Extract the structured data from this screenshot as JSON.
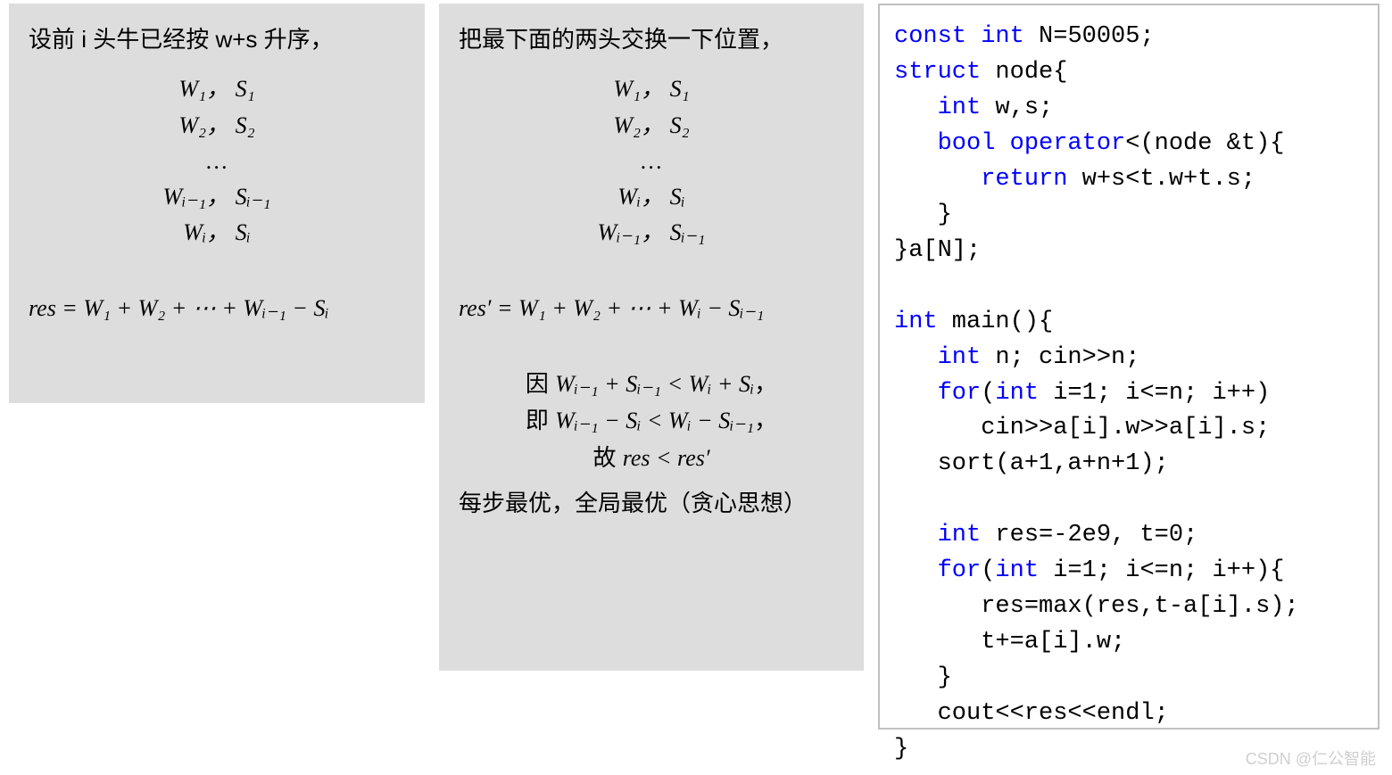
{
  "left": {
    "title": "设前 i 头牛已经按 w+s 升序，",
    "rows": [
      "W₁，  S₁",
      "W₂，  S₂",
      "…",
      "Wᵢ₋₁，  Sᵢ₋₁",
      "Wᵢ，  Sᵢ"
    ],
    "result": "res = W₁ + W₂ + ⋯ + Wᵢ₋₁ − Sᵢ"
  },
  "mid": {
    "title": "把最下面的两头交换一下位置，",
    "rows": [
      "W₁，  S₁",
      "W₂，  S₂",
      "…",
      "Wᵢ，  Sᵢ",
      "Wᵢ₋₁，  Sᵢ₋₁"
    ],
    "result": "res′ = W₁ + W₂ + ⋯ + Wᵢ − Sᵢ₋₁",
    "proof1_pre": "因 ",
    "proof1_math": "Wᵢ₋₁ + Sᵢ₋₁ < Wᵢ + Sᵢ",
    "proof1_post": "，",
    "proof2_pre": "即 ",
    "proof2_math": "Wᵢ₋₁ − Sᵢ < Wᵢ − Sᵢ₋₁",
    "proof2_post": "，",
    "proof3_pre": "故 ",
    "proof3_math": "res < res′",
    "conclusion": "每步最优，全局最优（贪心思想）"
  },
  "code": {
    "l1a": "const",
    "l1b": " int",
    "l1c": " N=",
    "l1d": "50005",
    "l1e": ";",
    "l2a": "struct",
    "l2b": " node{",
    "l3a": "   int",
    "l3b": " w,s;",
    "l4a": "   bool",
    "l4b": " operator",
    "l4c": "<(node &t){",
    "l5a": "      return",
    "l5b": " w+s<t.w+t.s;",
    "l6": "   }",
    "l7": "}a[N];",
    "l8": "",
    "l9a": "int",
    "l9b": " main(){",
    "l10a": "   int",
    "l10b": " n; cin>>n;",
    "l11a": "   for",
    "l11b": "(",
    "l11c": "int",
    "l11d": " i=",
    "l11e": "1",
    "l11f": "; i<=n; i++)",
    "l12": "      cin>>a[i].w>>a[i].s;",
    "l13a": "   sort(a+",
    "l13b": "1",
    "l13c": ",a+n+",
    "l13d": "1",
    "l13e": ");",
    "l14": "",
    "l15a": "   int",
    "l15b": " res=-",
    "l15c": "2e9",
    "l15d": ", t=",
    "l15e": "0",
    "l15f": ";",
    "l16a": "   for",
    "l16b": "(",
    "l16c": "int",
    "l16d": " i=",
    "l16e": "1",
    "l16f": "; i<=n; i++){",
    "l17": "      res=max(res,t-a[i].s);",
    "l18": "      t+=a[i].w;",
    "l19": "   }",
    "l20": "   cout<<res<<endl;",
    "l21": "}"
  },
  "watermark": "CSDN @仁公智能"
}
